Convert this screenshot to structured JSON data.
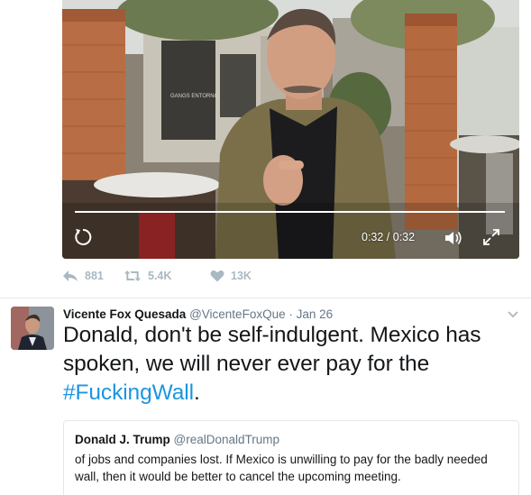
{
  "video": {
    "time_display": "0:32 / 0:32",
    "progress": 1.0,
    "scene_sign": "GANGS ENTORNO"
  },
  "actions": {
    "reply_count": "881",
    "retweet_count": "5.4K",
    "like_count": "13K"
  },
  "tweet": {
    "author_name": "Vicente Fox Quesada",
    "author_handle": "@VicenteFoxQue",
    "separator": "·",
    "date": "Jan 26",
    "text": "Donald, don't be self-indulgent. Mexico has spoken, we will never ever pay for the ",
    "hashtag": "#FuckingWall",
    "text_end": "."
  },
  "quoted_tweet": {
    "author_name": "Donald J. Trump",
    "author_handle": "@realDonaldTrump",
    "text": "of jobs and companies lost. If Mexico is unwilling to pay for the badly needed wall, then it would be better to cancel the upcoming meeting."
  },
  "colors": {
    "link": "#1b95e0",
    "muted": "#657786",
    "icon_gray": "#aab8c2",
    "border": "#e1e8ed"
  },
  "icons": [
    "replay-icon",
    "volume-icon",
    "fullscreen-icon",
    "reply-icon",
    "retweet-icon",
    "like-icon",
    "chevron-down-icon"
  ]
}
